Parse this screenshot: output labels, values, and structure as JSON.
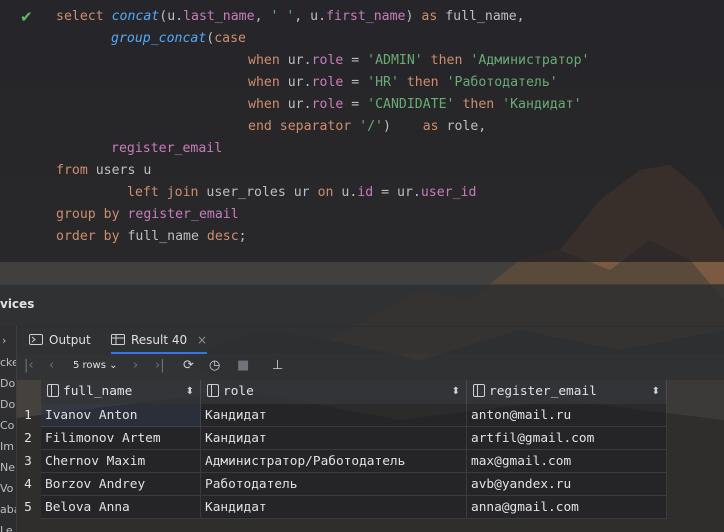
{
  "editor": {
    "lines": [
      {
        "kw1": "select",
        "fn": "concat",
        "p1": "(",
        "t1": "u",
        "d1": ".",
        "f1": "last_name",
        "c1": ", ",
        "s1": "' '",
        "c2": ", ",
        "t2": "u",
        "d2": ".",
        "f2": "first_name",
        "p2": ")",
        "kw2": " as ",
        "al": "full_name",
        "c3": ","
      },
      {
        "fn": "group_concat",
        "p1": "(",
        "kw": "case"
      },
      {
        "kw1": "when",
        "t": "ur",
        "d": ".",
        "f": "role",
        "op": " = ",
        "s1": "'ADMIN'",
        "kw2": " then ",
        "s2": "'Администратор'"
      },
      {
        "kw1": "when",
        "t": "ur",
        "d": ".",
        "f": "role",
        "op": " = ",
        "s1": "'HR'",
        "kw2": " then ",
        "s2": "'Работодатель'"
      },
      {
        "kw1": "when",
        "t": "ur",
        "d": ".",
        "f": "role",
        "op": " = ",
        "s1": "'CANDIDATE'",
        "kw2": " then ",
        "s2": "'Кандидат'"
      },
      {
        "kw1": "end",
        "kw2": " separator ",
        "s1": "'/'",
        "p": ")",
        "kw3": "    as ",
        "al": "role",
        "c": ","
      },
      {
        "f": "register_email"
      },
      {
        "kw": "from",
        "id": " users u"
      },
      {
        "kw1": "left join",
        "id1": " user_roles ur ",
        "kw2": "on",
        "t1": " u",
        ".": ".",
        "f1": "id",
        "op": " = ",
        "t2": "ur",
        "d2": ".",
        "f2": "user_id"
      },
      {
        "kw": "group by",
        "sp": " ",
        "f": "register_email"
      },
      {
        "kw": "order by",
        "id": " full_name ",
        "kw2": "desc",
        "c": ";"
      }
    ]
  },
  "services": {
    "title": "vices"
  },
  "left_panel": {
    "items": [
      "cke",
      "Do",
      "Do",
      "Co",
      "Im",
      "Ne",
      "Vo",
      "aba",
      "Le"
    ]
  },
  "tabs": [
    {
      "label": "Output"
    },
    {
      "label": "Result 40",
      "close": "×"
    }
  ],
  "toolbar": {
    "rows_label": "5 rows"
  },
  "grid": {
    "columns": [
      "full_name",
      "role",
      "register_email"
    ],
    "rows": [
      {
        "n": "1",
        "full_name": "Ivanov Anton",
        "role": "Кандидат",
        "register_email": "anton@mail.ru"
      },
      {
        "n": "2",
        "full_name": "Filimonov Artem",
        "role": "Кандидат",
        "register_email": "artfil@gmail.com"
      },
      {
        "n": "3",
        "full_name": "Chernov Maxim",
        "role": "Администратор/Работодатель",
        "register_email": "max@gmail.com"
      },
      {
        "n": "4",
        "full_name": "Borzov Andrey",
        "role": "Работодатель",
        "register_email": "avb@yandex.ru"
      },
      {
        "n": "5",
        "full_name": "Belova Anna",
        "role": "Кандидат",
        "register_email": "anna@gmail.com"
      }
    ]
  },
  "colors": {
    "accent": "#3574f0",
    "keyword": "#cf8e6d",
    "function": "#56a8f5",
    "field": "#c77dbb",
    "string": "#6aab73"
  }
}
